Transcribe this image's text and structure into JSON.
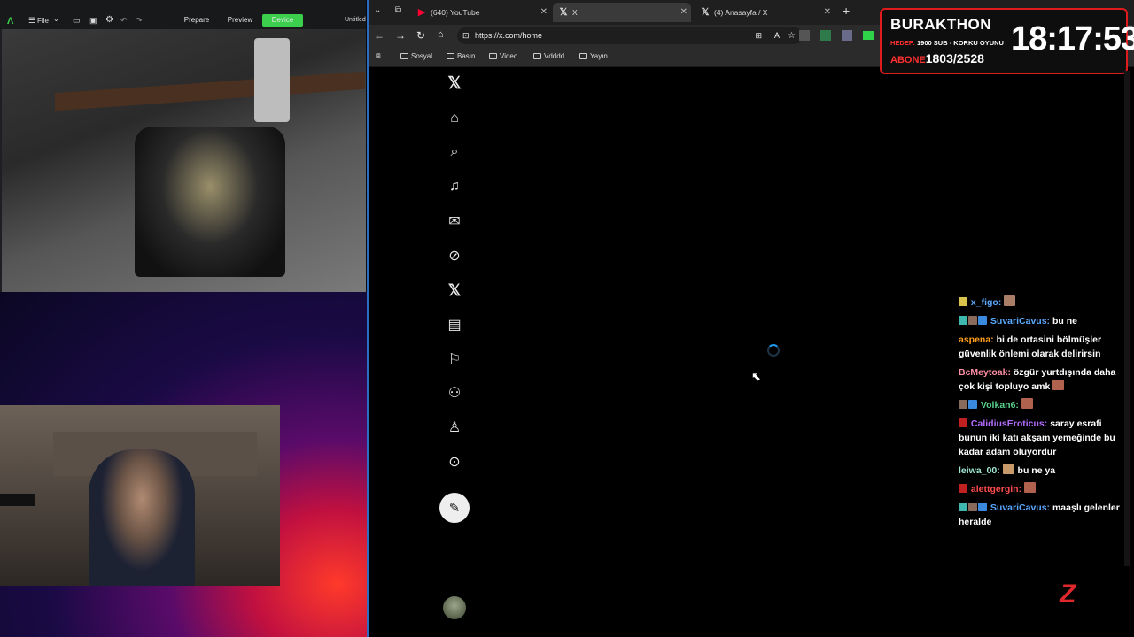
{
  "slicer": {
    "menu_file": "File",
    "tabs": {
      "prepare": "Prepare",
      "preview": "Preview",
      "device": "Device"
    },
    "project_title": "Untitled"
  },
  "browser": {
    "tabs": [
      {
        "label": "(640) YouTube",
        "icon": "youtube-icon"
      },
      {
        "label": "X",
        "icon": "x-logo-icon"
      },
      {
        "label": "(4) Anasayfa / X",
        "icon": "x-logo-icon"
      }
    ],
    "new_tab": "+",
    "url": "https://x.com/home",
    "bookmarks": [
      "Sosyal",
      "Basın",
      "Video",
      "Vdddd",
      "Yayın"
    ]
  },
  "x_nav": [
    "x-logo-icon",
    "home-icon",
    "search-icon",
    "bell-icon",
    "mail-icon",
    "grok-icon",
    "x-premium-icon",
    "lists-icon",
    "bookmark-icon",
    "communities-icon",
    "profile-icon",
    "more-icon"
  ],
  "overlay": {
    "title": "BURAKTHON",
    "goal_label": "HEDEF:",
    "goal_text": "1900 SUB - KORKU OYUNU",
    "abone_label": "ABONE",
    "abone_count": "1803/2528",
    "clock": "18:17:53"
  },
  "chat": [
    {
      "user": "x_figo:",
      "color": "#5aa9ff",
      "text": ""
    },
    {
      "user": "SuvariCavus:",
      "color": "#5aa9ff",
      "text": "bu ne"
    },
    {
      "user": "aspena:",
      "color": "#ff9f1c",
      "text": "bi de ortasini bölmüşler güvenlik önlemi olarak delirirsin"
    },
    {
      "user": "BcMeytoak:",
      "color": "#ff8fa3",
      "text": "özgür yurtdışında daha çok kişi topluyo amk"
    },
    {
      "user": "Volkan6:",
      "color": "#59d38c",
      "text": ""
    },
    {
      "user": "CalidiusEroticus:",
      "color": "#b36bff",
      "text": "saray esrafi bunun iki katı akşam yemeğinde bu kadar adam oluyordur"
    },
    {
      "user": "leiwa_00:",
      "color": "#9fe6d2",
      "text": "bu ne ya"
    },
    {
      "user": "alettgergin:",
      "color": "#ff4d4d",
      "text": ""
    },
    {
      "user": "SuvariCavus:",
      "color": "#5aa9ff",
      "text": "maaşlı gelenler heralde"
    }
  ],
  "colors": {
    "accent": "#1d9bf0",
    "device_tab": "#3ccf4e",
    "overlay_border": "#e01b1b"
  }
}
